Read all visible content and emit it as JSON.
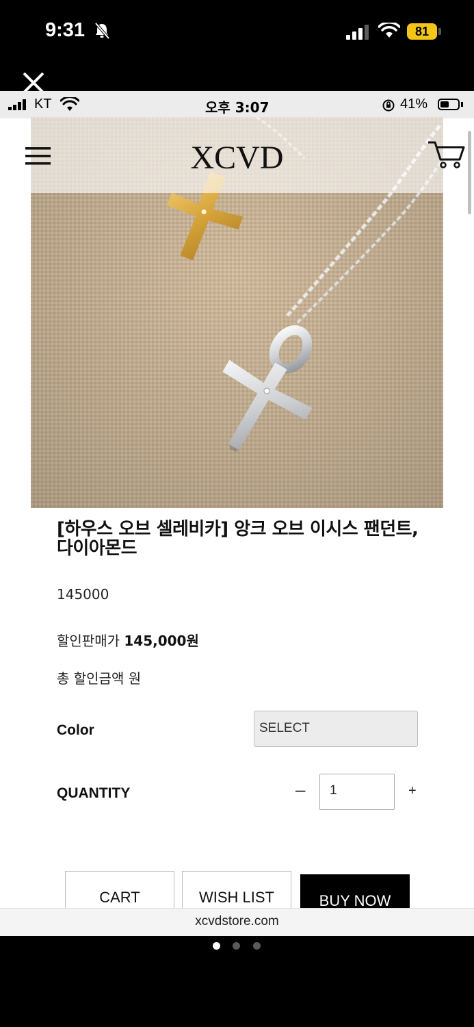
{
  "device_status": {
    "time": "9:31",
    "battery": "81"
  },
  "inner_status": {
    "carrier": "KT",
    "time": "오후 3:07",
    "battery_pct": "41%"
  },
  "header": {
    "brand": "XCVD"
  },
  "product": {
    "title": "[하우스 오브 셀레비카] 앙크 오브 이시스 팬던트, 다이아몬드",
    "price": "145000",
    "sale_label": "할인판매가",
    "sale_amount": "145,000원",
    "total_discount": "총 할인금액 원"
  },
  "options": {
    "color_label": "Color",
    "color_value": "SELECT",
    "quantity_label": "QUANTITY",
    "quantity_minus": "–",
    "quantity_value": "1",
    "quantity_plus": "+"
  },
  "actions": {
    "cart": "CART",
    "wishlist": "WISH LIST",
    "buy_now": "BUY NOW"
  },
  "address_bar": {
    "url": "xcvdstore.com"
  },
  "pager": {
    "count": 3,
    "active": 1
  },
  "icons": [
    "mute-icon",
    "signal-icon",
    "wifi-icon",
    "battery-icon",
    "close-icon",
    "menu-icon",
    "cart-icon",
    "rotation-lock-icon"
  ]
}
